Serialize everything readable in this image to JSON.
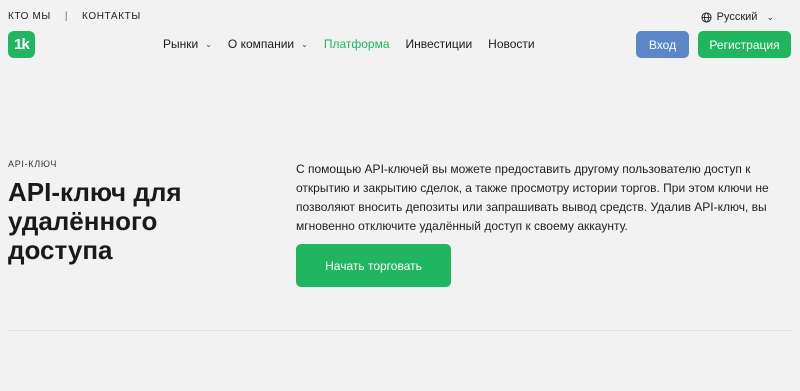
{
  "topbar": {
    "about": "КТО МЫ",
    "separator": "|",
    "contacts": "КОНТАКТЫ"
  },
  "language": {
    "label": "Русский",
    "icon": "globe-icon"
  },
  "logo": {
    "text": "1k"
  },
  "nav": {
    "items": [
      {
        "label": "Рынки",
        "has_dropdown": true
      },
      {
        "label": "О компании",
        "has_dropdown": true
      },
      {
        "label": "Платформа",
        "active": true
      },
      {
        "label": "Инвестиции"
      },
      {
        "label": "Новости"
      }
    ]
  },
  "auth": {
    "login_label": "Вход",
    "register_label": "Регистрация"
  },
  "hero": {
    "eyebrow": "API-КЛЮЧ",
    "title": "API-ключ для удалённого доступа",
    "description": "С помощью API-ключей вы можете предоставить другому пользователю доступ к открытию и закрытию сделок, а также просмотру истории торгов. При этом ключи не позволяют вносить депозиты или запрашивать вывод средств. Удалив API-ключ, вы мгновенно отключите удалённый доступ к своему аккаунту.",
    "cta_label": "Начать торговать"
  },
  "colors": {
    "brand_green": "#1fb65f",
    "login_blue": "#5b86c8",
    "background": "#f2f2f2"
  }
}
